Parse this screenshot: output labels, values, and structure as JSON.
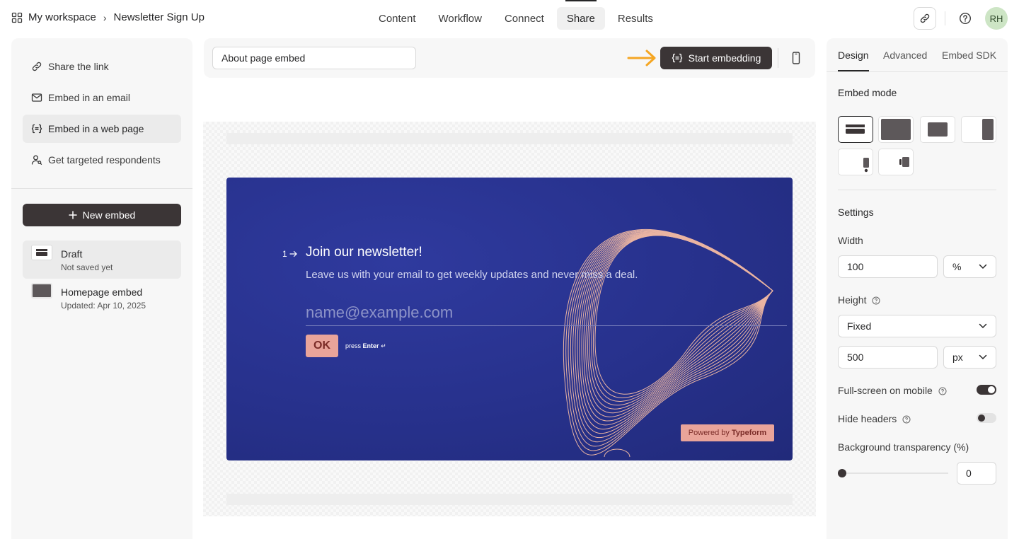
{
  "header": {
    "workspace": "My workspace",
    "form_name": "Newsletter Sign Up",
    "tabs": [
      {
        "label": "Content"
      },
      {
        "label": "Workflow"
      },
      {
        "label": "Connect"
      },
      {
        "label": "Share",
        "active": true
      },
      {
        "label": "Results"
      }
    ],
    "avatar": "RH",
    "icons": [
      "grid-icon",
      "link-icon",
      "help-icon"
    ]
  },
  "share_menu": {
    "items": [
      {
        "label": "Share the link",
        "icon": "link-icon"
      },
      {
        "label": "Embed in an email",
        "icon": "mail-icon"
      },
      {
        "label": "Embed in a web page",
        "icon": "embed-code-icon",
        "active": true
      },
      {
        "label": "Get targeted respondents",
        "icon": "user-search-icon"
      }
    ],
    "new_embed": "New embed",
    "embeds": [
      {
        "name": "Draft",
        "sub": "Not saved yet",
        "active": true
      },
      {
        "name": "Homepage embed",
        "sub": "Updated: Apr 10, 2025"
      }
    ]
  },
  "toolbar": {
    "embed_name": "About page embed",
    "start_button": "Start embedding"
  },
  "preview": {
    "question_number": "1",
    "title": "Join our newsletter!",
    "description": "Leave us with your email to get weekly updates and never miss a deal.",
    "input_placeholder": "name@example.com",
    "ok_label": "OK",
    "press_label": "press",
    "enter_label": "Enter",
    "powered_prefix": "Powered by",
    "powered_brand": "Typeform"
  },
  "design_panel": {
    "tabs": [
      {
        "label": "Design",
        "active": true
      },
      {
        "label": "Advanced"
      },
      {
        "label": "Embed SDK"
      }
    ],
    "embed_mode_label": "Embed mode",
    "settings_label": "Settings",
    "width_label": "Width",
    "width_value": "100",
    "width_unit": "%",
    "height_label": "Height",
    "height_mode": "Fixed",
    "height_value": "500",
    "height_unit": "px",
    "fullscreen_label": "Full-screen on mobile",
    "fullscreen_on": true,
    "hide_headers_label": "Hide headers",
    "hide_headers_on": false,
    "bg_transparency_label": "Background transparency (%)",
    "bg_transparency_value": "0"
  },
  "colors": {
    "accent_dark": "#3b3536",
    "form_background": "#27318c",
    "form_button": "#e9a49a",
    "arrow_highlight": "#f5a623"
  }
}
